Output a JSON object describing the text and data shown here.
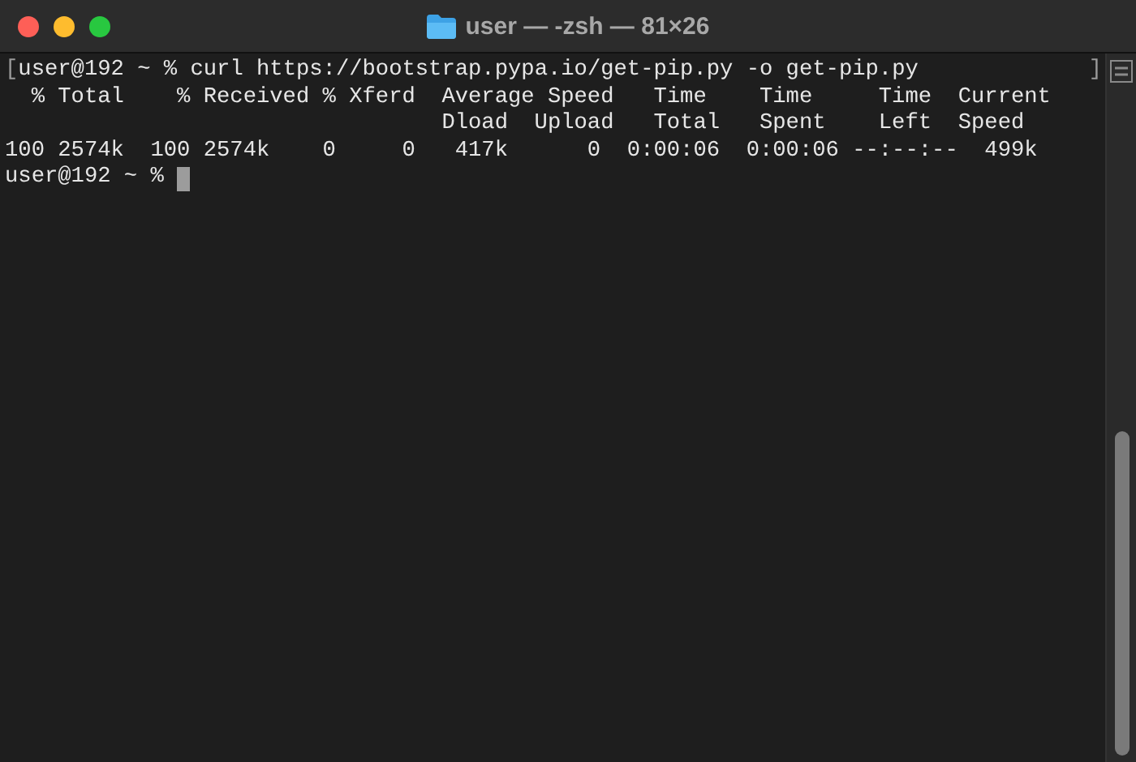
{
  "window": {
    "title": "user — -zsh — 81×26"
  },
  "terminal": {
    "lines": [
      {
        "kind": "command",
        "mark_open": "[",
        "text": "user@192 ~ % curl https://bootstrap.pypa.io/get-pip.py -o get-pip.py",
        "mark_close": "]"
      },
      {
        "kind": "output",
        "text": "  % Total    % Received % Xferd  Average Speed   Time    Time     Time  Current"
      },
      {
        "kind": "output",
        "text": "                                 Dload  Upload   Total   Spent    Left  Speed"
      },
      {
        "kind": "output",
        "text": "100 2574k  100 2574k    0     0   417k      0  0:00:06  0:00:06 --:--:--  499k"
      },
      {
        "kind": "prompt",
        "text": "user@192 ~ % "
      }
    ]
  }
}
